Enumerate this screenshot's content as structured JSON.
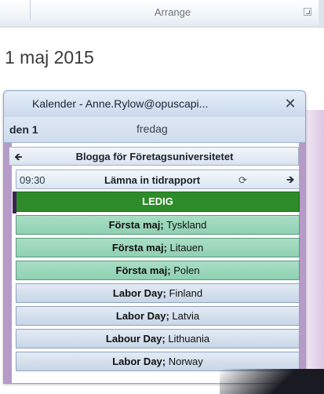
{
  "ribbon": {
    "group_label": "Arrange"
  },
  "date_title": "1 maj 2015",
  "window": {
    "title": "Kalender - Anne.Rylow@opuscapi...",
    "close_glyph": "✕"
  },
  "day_header": {
    "day_number": "den 1",
    "weekday": "fredag"
  },
  "all_day_event": {
    "label": "Blogga för Företagsuniversitetet",
    "left_arrow": "🡸"
  },
  "appointment": {
    "time": "09:30",
    "label": "Lämna in tidrapport",
    "recurrence_glyph": "⟳",
    "right_arrow": "🡺"
  },
  "events": [
    {
      "bold": "LEDIG",
      "rest": "",
      "style": "free"
    },
    {
      "bold": "Första maj;",
      "rest": " Tyskland",
      "style": "green"
    },
    {
      "bold": "Första maj;",
      "rest": " Litauen",
      "style": "green"
    },
    {
      "bold": "Första maj;",
      "rest": " Polen",
      "style": "green"
    },
    {
      "bold": "Labor Day;",
      "rest": " Finland",
      "style": "blue"
    },
    {
      "bold": "Labor Day;",
      "rest": " Latvia",
      "style": "blue"
    },
    {
      "bold": "Labour Day;",
      "rest": " Lithuania",
      "style": "blue"
    },
    {
      "bold": "Labor Day;",
      "rest": " Norway",
      "style": "blue"
    }
  ],
  "colors": {
    "free": "#2e8b2a",
    "holiday_green": "#9fd8bd",
    "holiday_blue": "#d6e0ed",
    "calendar_accent": "#b69ac7"
  }
}
